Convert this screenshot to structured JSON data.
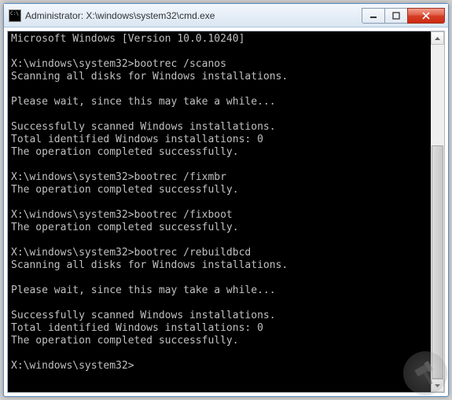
{
  "titlebar": {
    "text": "Administrator: X:\\windows\\system32\\cmd.exe"
  },
  "console": {
    "lines": [
      "Microsoft Windows [Version 10.0.10240]",
      "",
      "X:\\windows\\system32>bootrec /scanos",
      "Scanning all disks for Windows installations.",
      "",
      "Please wait, since this may take a while...",
      "",
      "Successfully scanned Windows installations.",
      "Total identified Windows installations: 0",
      "The operation completed successfully.",
      "",
      "X:\\windows\\system32>bootrec /fixmbr",
      "The operation completed successfully.",
      "",
      "X:\\windows\\system32>bootrec /fixboot",
      "The operation completed successfully.",
      "",
      "X:\\windows\\system32>bootrec /rebuildbcd",
      "Scanning all disks for Windows installations.",
      "",
      "Please wait, since this may take a while...",
      "",
      "Successfully scanned Windows installations.",
      "Total identified Windows installations: 0",
      "The operation completed successfully.",
      "",
      "X:\\windows\\system32>"
    ]
  }
}
